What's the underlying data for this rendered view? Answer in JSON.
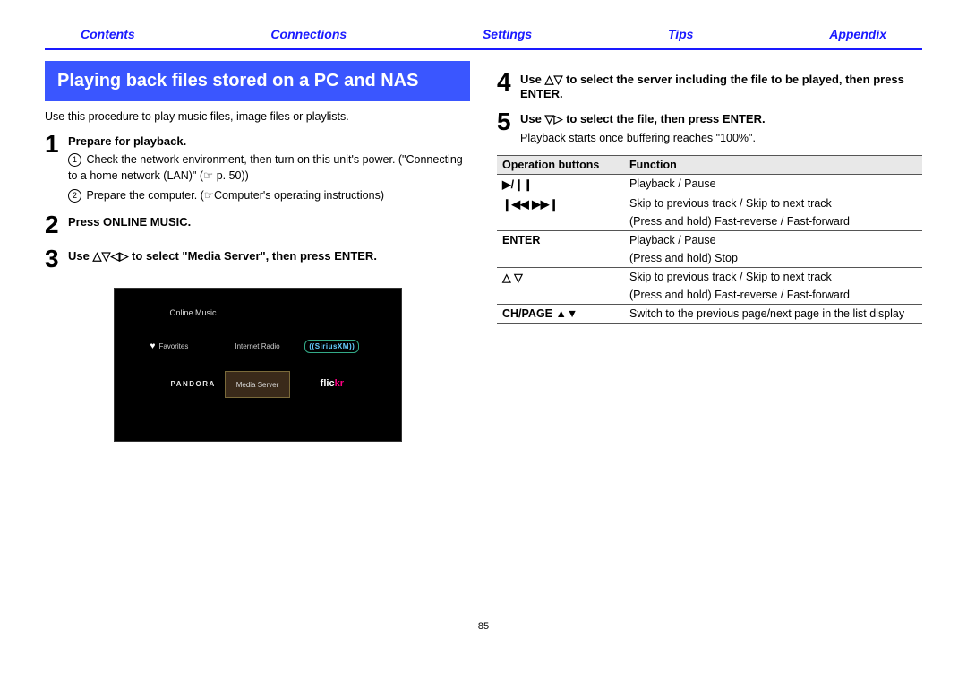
{
  "nav": {
    "contents": "Contents",
    "connections": "Connections",
    "settings": "Settings",
    "tips": "Tips",
    "appendix": "Appendix"
  },
  "left": {
    "heading": "Playing back files stored on a PC and NAS",
    "intro": "Use this procedure to play music files, image files or playlists.",
    "step1_title": "Prepare for playback.",
    "step1_a": "Check the network environment, then turn on this unit's power. (\"Connecting to a home network (LAN)\" (☞ p. 50))",
    "step1_b": "Prepare the computer. (☞Computer's operating instructions)",
    "step2_title": "Press ONLINE MUSIC.",
    "step3_title": "Use △▽◁▷ to select \"Media Server\", then press ENTER.",
    "ui": {
      "title": "Online Music",
      "favorites": "Favorites",
      "internet_radio": "Internet Radio",
      "siriusxm": "SiriusXM",
      "pandora": "PANDORA",
      "media_server": "Media Server",
      "flickr_f": "flic",
      "flickr_kr": "kr"
    }
  },
  "right": {
    "step4_title": "Use △▽ to select the server including the file to be played, then press ENTER.",
    "step5_title": "Use ▽▷ to select the file, then press ENTER.",
    "step5_sub": "Playback starts once buffering reaches \"100%\".",
    "table": {
      "h1": "Operation buttons",
      "h2": "Function",
      "r1b": "▶/❙❙",
      "r1f": "Playback / Pause",
      "r2b": "❙◀◀ ▶▶❙",
      "r2f1": "Skip to previous track / Skip to next track",
      "r2f2": "(Press and hold) Fast-reverse / Fast-forward",
      "r3b": "ENTER",
      "r3f1": "Playback / Pause",
      "r3f2": "(Press and hold) Stop",
      "r4b": "△ ▽",
      "r4f1": "Skip to previous track / Skip to next track",
      "r4f2": "(Press and hold) Fast-reverse / Fast-forward",
      "r5b": "CH/PAGE ▲▼",
      "r5f": "Switch to the previous page/next page in the list display"
    }
  },
  "pagenum": "85"
}
